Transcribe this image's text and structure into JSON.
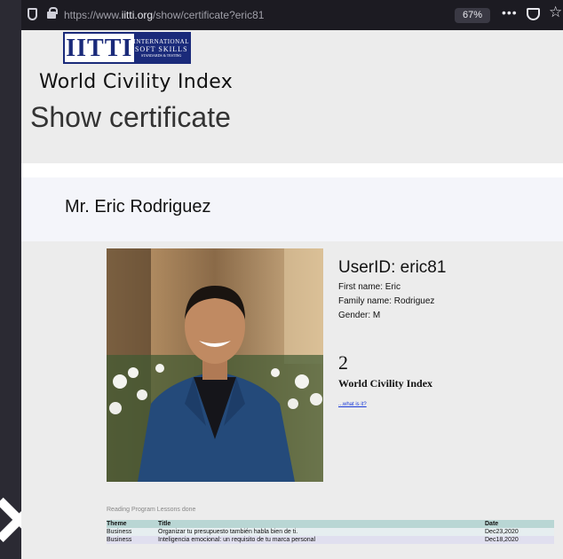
{
  "browser": {
    "url_prefix": "https://www.",
    "url_domain": "iitti.org",
    "url_path": "/show/certificate?eric81",
    "zoom": "67%",
    "menu_dots": "•••"
  },
  "logo": {
    "main": "IITTI",
    "line1": "INTERNATIONAL",
    "line2": "SOFT SKILLS",
    "line3": "STANDARDS & TESTING"
  },
  "header": {
    "brand_title": "World Civility Index",
    "page_title": "Show certificate"
  },
  "person": {
    "display_name": "Mr. Eric Rodriguez",
    "userid": "UserID: eric81",
    "first_name": "First name: Eric",
    "family_name": "Family name: Rodriguez",
    "gender": "Gender: M"
  },
  "index": {
    "value": "2",
    "label": "World Civility Index",
    "link": "...what is it?"
  },
  "lessons": {
    "title": "Reading Program Lessons done",
    "headers": {
      "theme": "Theme",
      "title": "Title",
      "date": "Date"
    },
    "rows": [
      {
        "theme": "Business",
        "title": "Organizar tu presupuesto también habla bien de ti.",
        "date": "Dec23,2020"
      },
      {
        "theme": "Business",
        "title": "Inteligencia emocional: un requisito de tu marca personal",
        "date": "Dec18,2020"
      }
    ]
  }
}
